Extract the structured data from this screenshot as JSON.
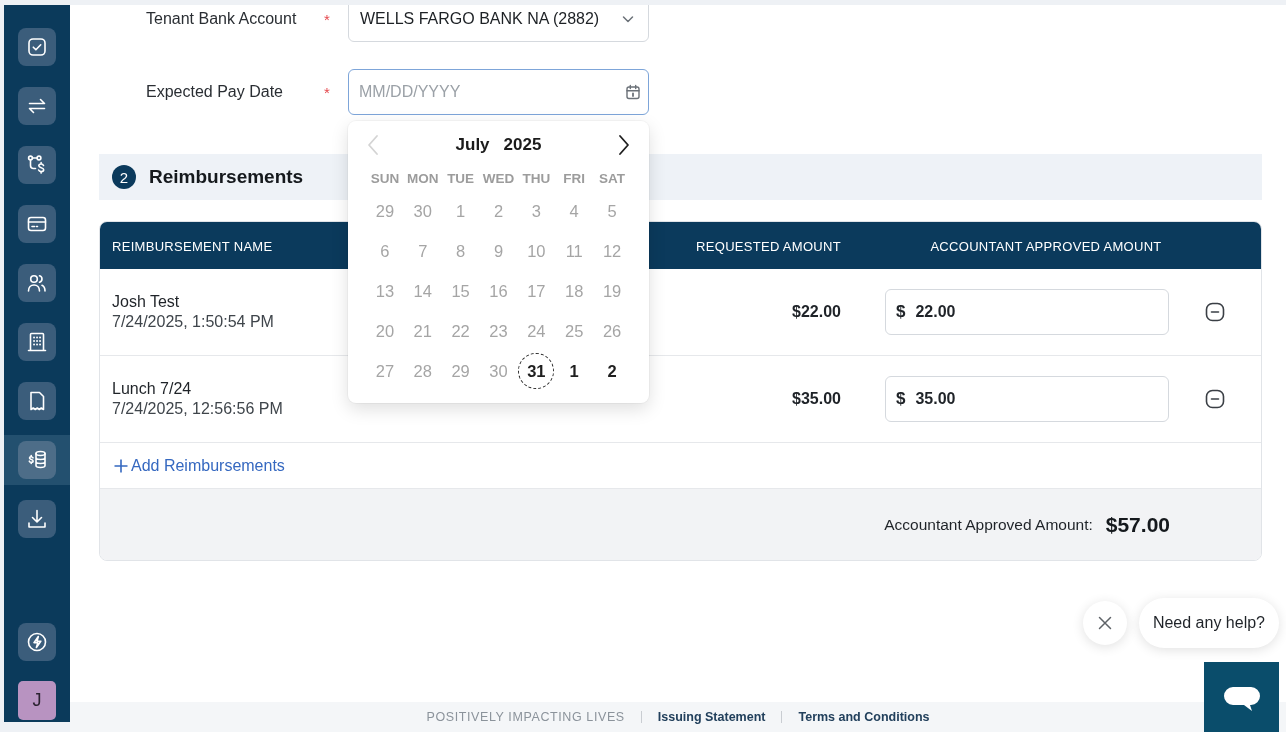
{
  "sidebar": {
    "items": [
      {
        "selected": false
      },
      {
        "selected": false
      },
      {
        "selected": false
      },
      {
        "selected": false
      },
      {
        "selected": false
      },
      {
        "selected": false
      },
      {
        "selected": false
      },
      {
        "selected": true
      },
      {
        "selected": false
      }
    ],
    "footer_items": [
      {
        "selected": false
      }
    ],
    "avatar": {
      "initial": "J"
    }
  },
  "form": {
    "fields": [
      {
        "kind": "select",
        "label": "Tenant Bank Account",
        "required_mark": "*",
        "value": "WELLS FARGO BANK NA (2882)",
        "focused": false
      },
      {
        "kind": "date",
        "label": "Expected Pay Date",
        "required_mark": "*",
        "placeholder": "MM/DD/YYYY",
        "focused": true
      }
    ]
  },
  "date_picker": {
    "month": "July",
    "year": "2025",
    "prev_disabled": true,
    "next_disabled": false,
    "weekdays": [
      "SUN",
      "MON",
      "TUE",
      "WED",
      "THU",
      "FRI",
      "SAT"
    ],
    "weeks": [
      [
        {
          "day": "29",
          "disabled": true,
          "today": false
        },
        {
          "day": "30",
          "disabled": true,
          "today": false
        },
        {
          "day": "1",
          "disabled": true,
          "today": false
        },
        {
          "day": "2",
          "disabled": true,
          "today": false
        },
        {
          "day": "3",
          "disabled": true,
          "today": false
        },
        {
          "day": "4",
          "disabled": true,
          "today": false
        },
        {
          "day": "5",
          "disabled": true,
          "today": false
        }
      ],
      [
        {
          "day": "6",
          "disabled": true,
          "today": false
        },
        {
          "day": "7",
          "disabled": true,
          "today": false
        },
        {
          "day": "8",
          "disabled": true,
          "today": false
        },
        {
          "day": "9",
          "disabled": true,
          "today": false
        },
        {
          "day": "10",
          "disabled": true,
          "today": false
        },
        {
          "day": "11",
          "disabled": true,
          "today": false
        },
        {
          "day": "12",
          "disabled": true,
          "today": false
        }
      ],
      [
        {
          "day": "13",
          "disabled": true,
          "today": false
        },
        {
          "day": "14",
          "disabled": true,
          "today": false
        },
        {
          "day": "15",
          "disabled": true,
          "today": false
        },
        {
          "day": "16",
          "disabled": true,
          "today": false
        },
        {
          "day": "17",
          "disabled": true,
          "today": false
        },
        {
          "day": "18",
          "disabled": true,
          "today": false
        },
        {
          "day": "19",
          "disabled": true,
          "today": false
        }
      ],
      [
        {
          "day": "20",
          "disabled": true,
          "today": false
        },
        {
          "day": "21",
          "disabled": true,
          "today": false
        },
        {
          "day": "22",
          "disabled": true,
          "today": false
        },
        {
          "day": "23",
          "disabled": true,
          "today": false
        },
        {
          "day": "24",
          "disabled": true,
          "today": false
        },
        {
          "day": "25",
          "disabled": true,
          "today": false
        },
        {
          "day": "26",
          "disabled": true,
          "today": false
        }
      ],
      [
        {
          "day": "27",
          "disabled": true,
          "today": false
        },
        {
          "day": "28",
          "disabled": true,
          "today": false
        },
        {
          "day": "29",
          "disabled": true,
          "today": false
        },
        {
          "day": "30",
          "disabled": true,
          "today": false
        },
        {
          "day": "31",
          "disabled": false,
          "today": true
        },
        {
          "day": "1",
          "disabled": false,
          "today": false
        },
        {
          "day": "2",
          "disabled": false,
          "today": false
        }
      ]
    ]
  },
  "section": {
    "number": "2",
    "title": "Reimbursements"
  },
  "table": {
    "columns": [
      "REIMBURSEMENT NAME",
      "REQUESTED AMOUNT",
      "ACCOUNTANT APPROVED AMOUNT"
    ],
    "rows": [
      {
        "name": "Josh Test",
        "timestamp": "7/24/2025, 1:50:54 PM",
        "requested": "$22.00",
        "currency": "$",
        "approved": "22.00"
      },
      {
        "name": "Lunch 7/24",
        "timestamp": "7/24/2025, 12:56:56 PM",
        "requested": "$35.00",
        "currency": "$",
        "approved": "35.00"
      }
    ],
    "add_link": "Add Reimbursements",
    "total": {
      "label": "Accountant Approved Amount:",
      "value": "$57.00"
    }
  },
  "chat": {
    "prompt": "Need any help?"
  },
  "footer": {
    "tagline": "POSITIVELY IMPACTING LIVES",
    "links": [
      "Issuing Statement",
      "Terms and Conditions"
    ]
  }
}
